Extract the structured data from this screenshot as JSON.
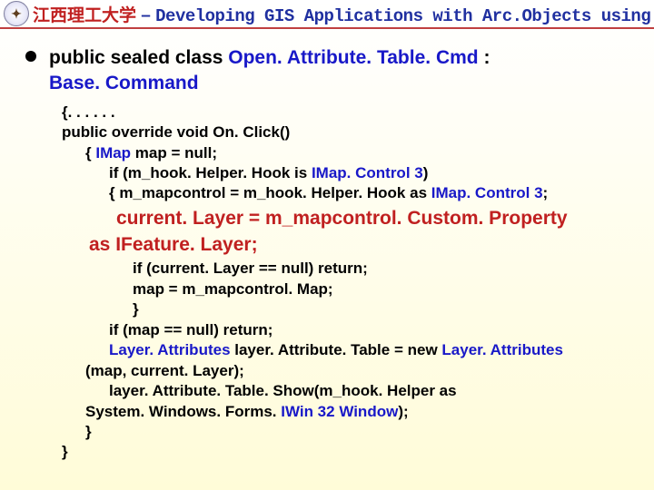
{
  "header": {
    "logo_text": "✦",
    "cn": "江西理工大学",
    "dash": " – ",
    "en": "Developing GIS Applications with Arc.Objects using C#. NE"
  },
  "decl": {
    "line1_kw": "public sealed class ",
    "line1_cls": "Open. Attribute. Table. Cmd ",
    "line1_colon": ": ",
    "line2_cls": "Base. Command"
  },
  "code": {
    "l1": "{. . . . . .",
    "l2a": "public override void ",
    "l2b": "On. Click()",
    "l3a": "{ ",
    "l3b": "IMap ",
    "l3c": "map = null;",
    "l4a": "if (m_hook. Helper. Hook is ",
    "l4b": "IMap. Control 3",
    "l4c": ")",
    "l5a": "{  m_mapcontrol = m_hook. Helper. Hook as ",
    "l5b": "IMap. Control 3",
    "l5c": ";",
    "hl1": "current. Layer = m_mapcontrol. Custom. Property",
    "hl2": "as IFeature. Layer;",
    "l6": "if (current. Layer == null) return;",
    "l7": "map = m_mapcontrol. Map;",
    "l8": "}",
    "l9": "if (map == null) return;",
    "l10a": "Layer. Attributes ",
    "l10b": "layer. Attribute. Table = new ",
    "l10c": "Layer. Attributes",
    "l11": "(map, current. Layer);",
    "l12": "layer. Attribute. Table. Show(m_hook. Helper as",
    "l13a": "System. Windows. Forms. ",
    "l13b": "IWin 32 Window",
    "l13c": ");",
    "l14": "}",
    "l15": "}"
  }
}
